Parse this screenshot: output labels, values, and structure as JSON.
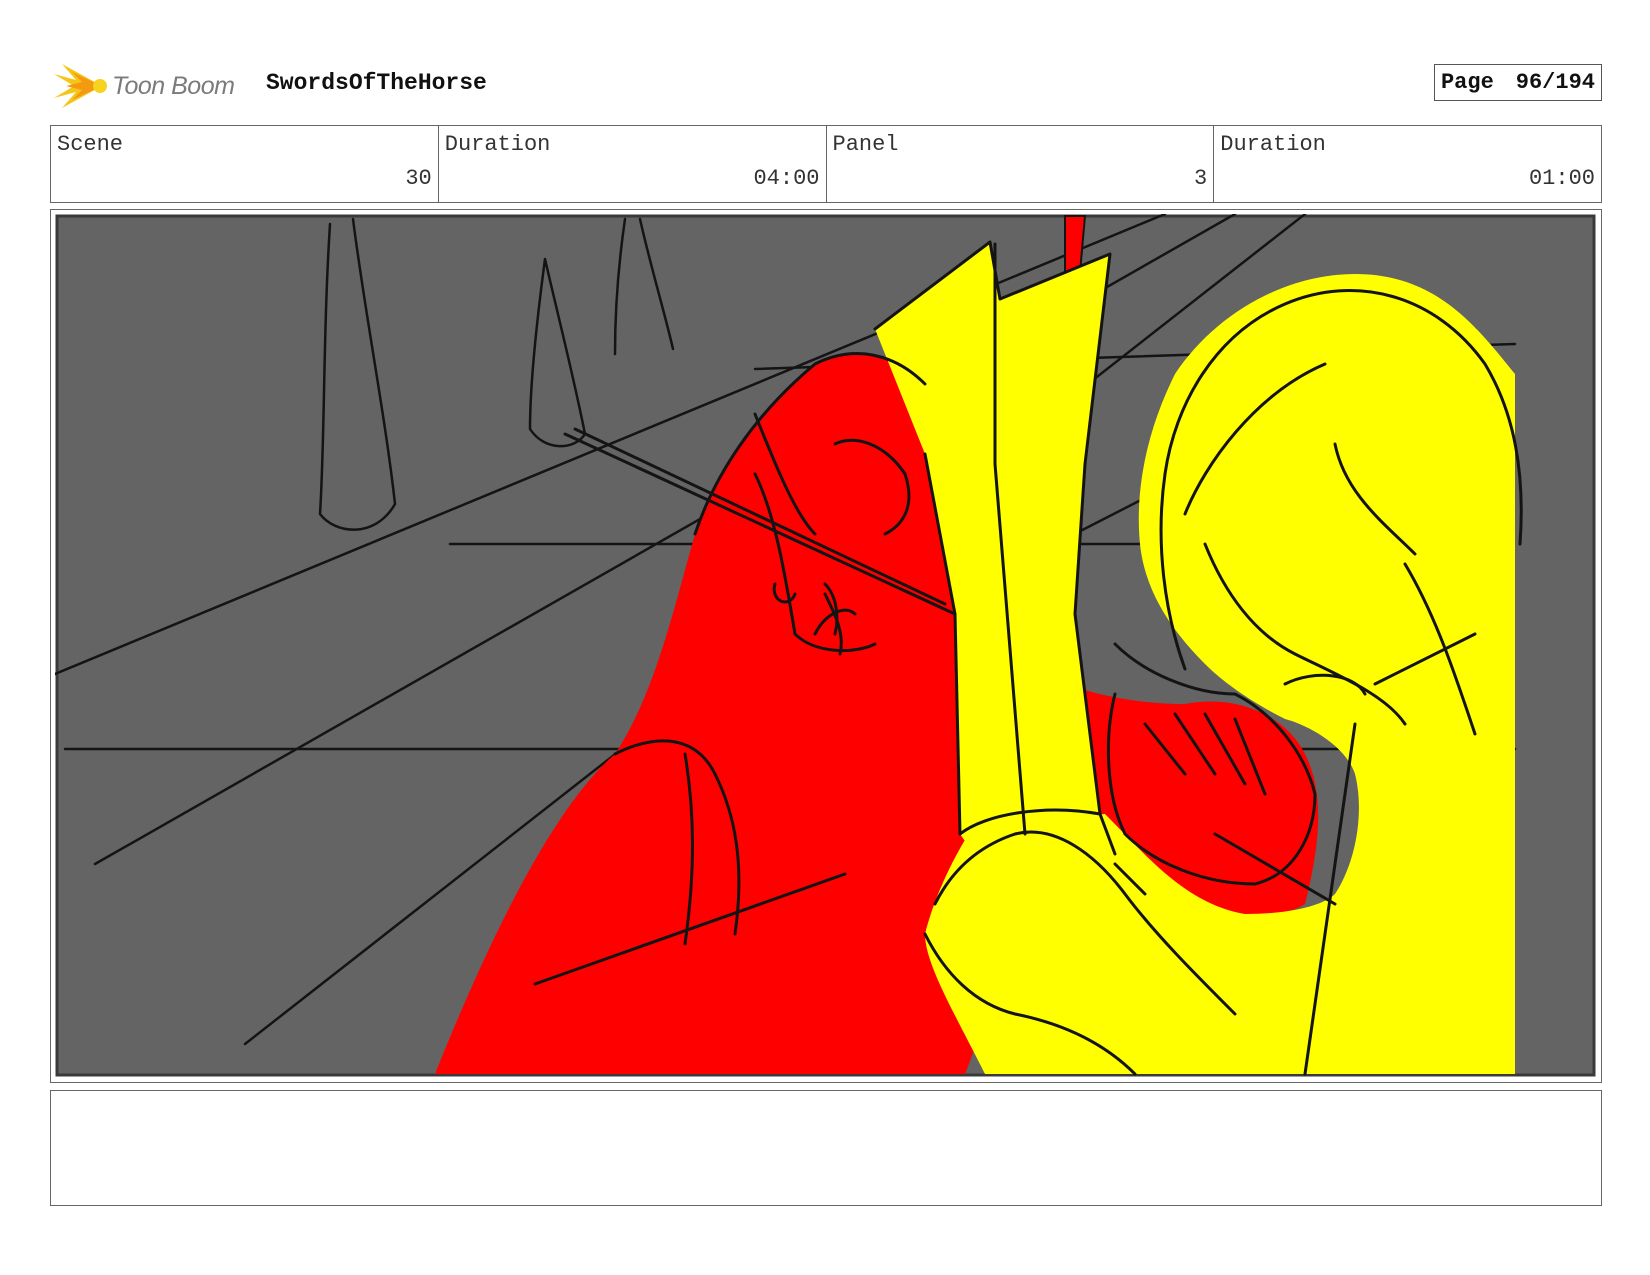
{
  "header": {
    "logo_text": "Toon Boom",
    "project_title": "SwordsOfTheHorse",
    "page_label": "Page",
    "page_value": "96/194"
  },
  "info": [
    {
      "label": "Scene",
      "value": "30"
    },
    {
      "label": "Duration",
      "value": "04:00"
    },
    {
      "label": "Panel",
      "value": "3"
    },
    {
      "label": "Duration",
      "value": "01:00"
    }
  ],
  "colors": {
    "background": "#646464",
    "horse": "#ff0000",
    "rider": "#ffff00",
    "line": "#141414"
  },
  "notes": {
    "text": ""
  }
}
